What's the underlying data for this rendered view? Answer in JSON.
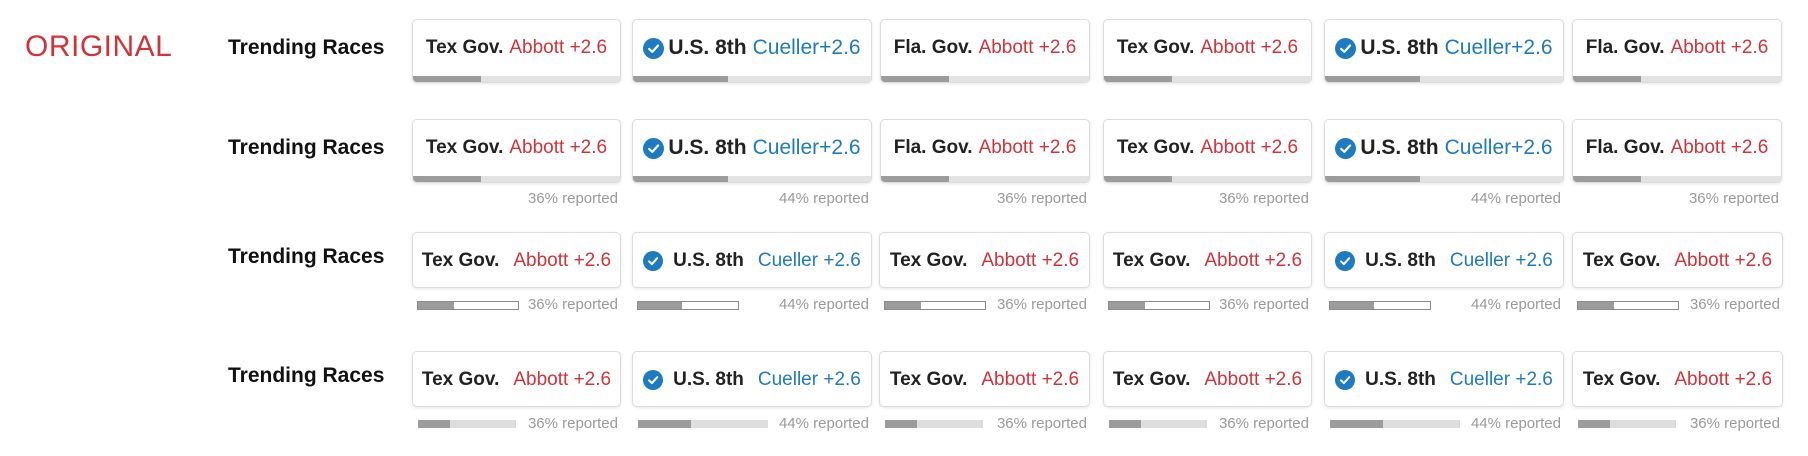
{
  "label": "ORIGINAL",
  "section_title": "Trending Races",
  "colors": {
    "label": "#d0343a",
    "republican": "#d0343a",
    "democrat": "#1f7bc1",
    "bar_fill": "#9c9c9c",
    "bar_track": "#e3e3e3",
    "reported_text": "#9a9a9a"
  },
  "rows": [
    {
      "title": "Trending Races",
      "style": "attached-bar",
      "races": [
        {
          "name": "Tex Gov.",
          "leader": "Abbott +2.6",
          "party": "red",
          "called": false,
          "reported": 0.36
        },
        {
          "name": "U.S. 8th",
          "leader": "Cueller+2.6",
          "party": "blue",
          "called": true,
          "reported": 0.44
        },
        {
          "name": "Fla. Gov.",
          "leader": "Abbott +2.6",
          "party": "red",
          "called": false,
          "reported": 0.36
        },
        {
          "name": "Tex Gov.",
          "leader": "Abbott +2.6",
          "party": "red",
          "called": false,
          "reported": 0.36
        },
        {
          "name": "U.S. 8th",
          "leader": "Cueller+2.6",
          "party": "blue",
          "called": true,
          "reported": 0.44
        },
        {
          "name": "Fla. Gov.",
          "leader": "Abbott +2.6",
          "party": "red",
          "called": false,
          "reported": 0.36
        }
      ]
    },
    {
      "title": "Trending Races",
      "style": "attached-bar-with-label",
      "races": [
        {
          "name": "Tex Gov.",
          "leader": "Abbott +2.6",
          "party": "red",
          "called": false,
          "reported": 0.36,
          "reported_text": "36% reported"
        },
        {
          "name": "U.S. 8th",
          "leader": "Cueller+2.6",
          "party": "blue",
          "called": true,
          "reported": 0.44,
          "reported_text": "44% reported"
        },
        {
          "name": "Fla. Gov.",
          "leader": "Abbott +2.6",
          "party": "red",
          "called": false,
          "reported": 0.36,
          "reported_text": "36% reported"
        },
        {
          "name": "Tex Gov.",
          "leader": "Abbott +2.6",
          "party": "red",
          "called": false,
          "reported": 0.36,
          "reported_text": "36% reported"
        },
        {
          "name": "U.S. 8th",
          "leader": "Cueller+2.6",
          "party": "blue",
          "called": true,
          "reported": 0.44,
          "reported_text": "44% reported"
        },
        {
          "name": "Fla. Gov.",
          "leader": "Abbott +2.6",
          "party": "red",
          "called": false,
          "reported": 0.36,
          "reported_text": "36% reported"
        }
      ]
    },
    {
      "title": "Trending Races",
      "style": "outlined-mini-bar",
      "races": [
        {
          "name": "Tex Gov.",
          "leader": "Abbott +2.6",
          "party": "red",
          "called": false,
          "reported": 0.36,
          "reported_text": "36% reported"
        },
        {
          "name": "U.S. 8th",
          "leader": "Cueller +2.6",
          "party": "blue",
          "called": true,
          "reported": 0.44,
          "reported_text": "44% reported"
        },
        {
          "name": "Tex Gov.",
          "leader": "Abbott +2.6",
          "party": "red",
          "called": false,
          "reported": 0.36,
          "reported_text": "36% reported"
        },
        {
          "name": "Tex Gov.",
          "leader": "Abbott +2.6",
          "party": "red",
          "called": false,
          "reported": 0.36,
          "reported_text": "36% reported"
        },
        {
          "name": "U.S. 8th",
          "leader": "Cueller +2.6",
          "party": "blue",
          "called": true,
          "reported": 0.44,
          "reported_text": "44% reported"
        },
        {
          "name": "Tex Gov.",
          "leader": "Abbott +2.6",
          "party": "red",
          "called": false,
          "reported": 0.36,
          "reported_text": "36% reported"
        }
      ]
    },
    {
      "title": "Trending Races",
      "style": "flat-mini-bar",
      "races": [
        {
          "name": "Tex Gov.",
          "leader": "Abbott +2.6",
          "party": "red",
          "called": false,
          "reported": 0.36,
          "reported_text": "36% reported"
        },
        {
          "name": "U.S. 8th",
          "leader": "Cueller +2.6",
          "party": "blue",
          "called": true,
          "reported": 0.44,
          "reported_text": "44% reported"
        },
        {
          "name": "Tex Gov.",
          "leader": "Abbott +2.6",
          "party": "red",
          "called": false,
          "reported": 0.36,
          "reported_text": "36% reported"
        },
        {
          "name": "Tex Gov.",
          "leader": "Abbott +2.6",
          "party": "red",
          "called": false,
          "reported": 0.36,
          "reported_text": "36% reported"
        },
        {
          "name": "U.S. 8th",
          "leader": "Cueller +2.6",
          "party": "blue",
          "called": true,
          "reported": 0.44,
          "reported_text": "44% reported"
        },
        {
          "name": "Tex Gov.",
          "leader": "Abbott +2.6",
          "party": "red",
          "called": false,
          "reported": 0.36,
          "reported_text": "36% reported"
        }
      ]
    }
  ]
}
